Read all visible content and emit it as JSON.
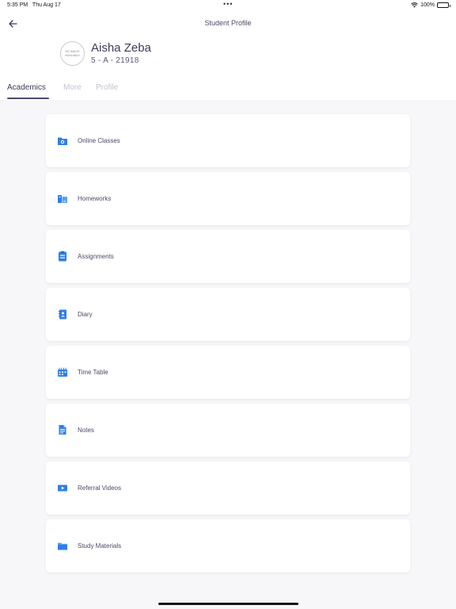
{
  "status_bar": {
    "time": "5:35 PM",
    "date": "Thu Aug 17",
    "dots": "•••",
    "battery_percent": "100%"
  },
  "header": {
    "title": "Student Profile",
    "back_icon": "arrow-left-icon"
  },
  "student": {
    "avatar_text": "NO IMAGE AVAILABLE",
    "name": "Aisha Zeba",
    "class_info": "5 - A - 21918"
  },
  "tabs": [
    {
      "label": "Academics",
      "active": true
    },
    {
      "label": "More",
      "active": false
    },
    {
      "label": "Profile",
      "active": false
    }
  ],
  "menu": [
    {
      "label": "Online Classes",
      "icon": "online-classes-icon"
    },
    {
      "label": "Homeworks",
      "icon": "homeworks-icon"
    },
    {
      "label": "Assignments",
      "icon": "assignments-icon"
    },
    {
      "label": "Diary",
      "icon": "diary-icon"
    },
    {
      "label": "Time Table",
      "icon": "time-table-icon"
    },
    {
      "label": "Notes",
      "icon": "notes-icon"
    },
    {
      "label": "Referral Videos",
      "icon": "referral-videos-icon"
    },
    {
      "label": "Study Materials",
      "icon": "study-materials-icon"
    }
  ],
  "colors": {
    "accent": "#4a4a6a",
    "icon_blue": "#2f7ee8",
    "inactive_tab": "#c3c3cf",
    "background": "#f7f7f9"
  }
}
